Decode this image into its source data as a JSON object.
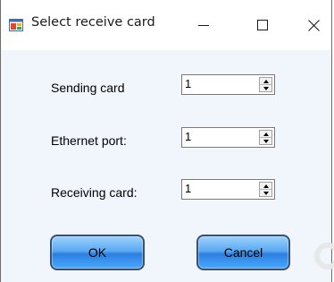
{
  "window": {
    "title": "Select receive card",
    "icon": "app-window-icon",
    "controls": {
      "minimize_icon": "minimize-icon",
      "maximize_icon": "maximize-icon",
      "close_icon": "close-icon"
    }
  },
  "form": {
    "sending_card": {
      "label": "Sending card",
      "value": "1"
    },
    "ethernet_port": {
      "label": "Ethernet port:",
      "value": "1"
    },
    "receiving_card": {
      "label": "Receiving card:",
      "value": "1"
    }
  },
  "buttons": {
    "ok_label": "OK",
    "cancel_label": "Cancel"
  },
  "colors": {
    "client_bg": "#f0f6fc",
    "button_blue": "#4aa8ff"
  }
}
